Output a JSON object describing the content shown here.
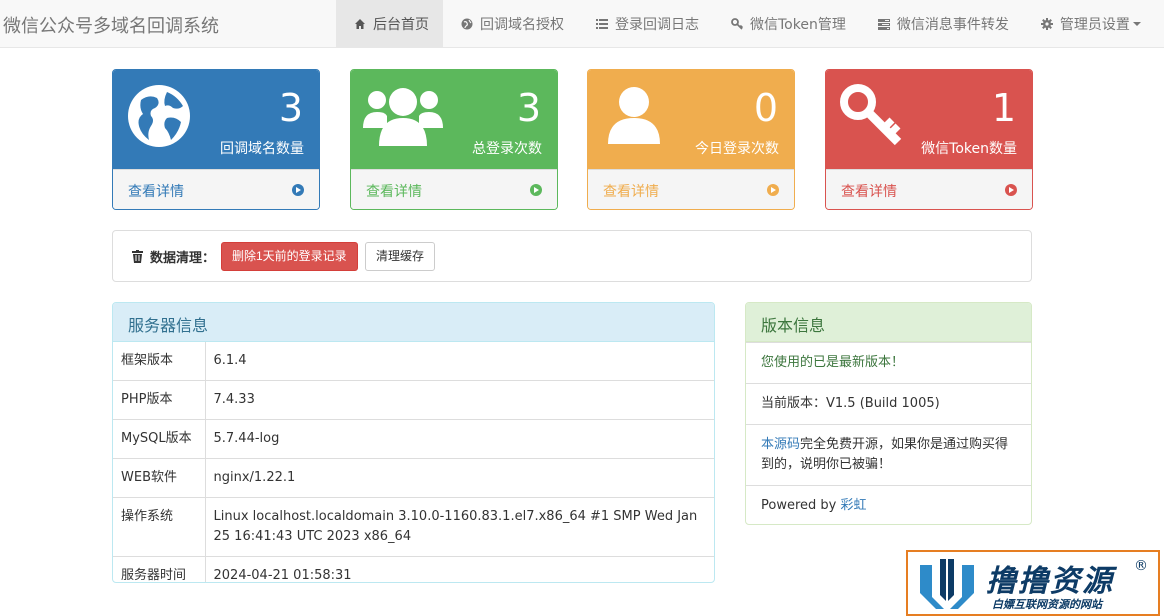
{
  "navbar": {
    "brand": "微信公众号多域名回调系统",
    "items": [
      {
        "label": "后台首页",
        "icon": "home-icon"
      },
      {
        "label": "回调域名授权",
        "icon": "globe-icon"
      },
      {
        "label": "登录回调日志",
        "icon": "list-icon"
      },
      {
        "label": "微信Token管理",
        "icon": "key-icon"
      },
      {
        "label": "微信消息事件转发",
        "icon": "tasks-icon"
      },
      {
        "label": "管理员设置",
        "icon": "cog-icon"
      }
    ]
  },
  "stats": [
    {
      "value": "3",
      "label": "回调域名数量",
      "more": "查看详情",
      "color": "#337ab7",
      "icon": "globe-icon"
    },
    {
      "value": "3",
      "label": "总登录次数",
      "more": "查看详情",
      "color": "#5cb85c",
      "icon": "users-icon"
    },
    {
      "value": "0",
      "label": "今日登录次数",
      "more": "查看详情",
      "color": "#f0ad4e",
      "icon": "user-icon"
    },
    {
      "value": "1",
      "label": "微信Token数量",
      "more": "查看详情",
      "color": "#d9534f",
      "icon": "key-icon"
    }
  ],
  "cleanup": {
    "title": "数据清理：",
    "delete_button": "删除1天前的登录记录",
    "clear_cache_button": "清理缓存"
  },
  "server": {
    "title": "服务器信息",
    "rows": [
      {
        "key": "框架版本",
        "value": "6.1.4"
      },
      {
        "key": "PHP版本",
        "value": "7.4.33"
      },
      {
        "key": "MySQL版本",
        "value": "5.7.44-log"
      },
      {
        "key": "WEB软件",
        "value": "nginx/1.22.1"
      },
      {
        "key": "操作系统",
        "value": "Linux localhost.localdomain 3.10.0-1160.83.1.el7.x86_64 #1 SMP Wed Jan 25 16:41:43 UTC 2023 x86_64"
      },
      {
        "key": "服务器时间",
        "value": "2024-04-21 01:58:31"
      }
    ]
  },
  "version": {
    "title": "版本信息",
    "latest_msg": "您使用的已是最新版本！",
    "current_label": "当前版本：V1.5 (Build 1005)",
    "source_link": "本源码",
    "source_text": "完全免费开源，如果你是通过购买得到的，说明你已被骗！",
    "powered_prefix": "Powered by ",
    "powered_link": "彩虹"
  },
  "watermark": {
    "title": "撸撸资源",
    "reg": "®",
    "subtitle": "白嫖互联网资源的网站"
  }
}
